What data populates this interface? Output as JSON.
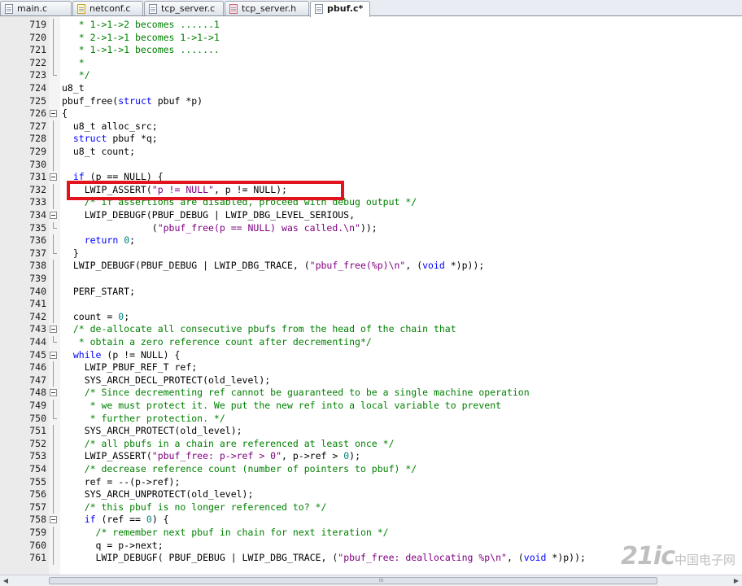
{
  "tabs": [
    {
      "label": "main.c",
      "color": "blue",
      "active": false
    },
    {
      "label": "netconf.c",
      "color": "yellow",
      "active": false
    },
    {
      "label": "tcp_server.c",
      "color": "blue",
      "active": false
    },
    {
      "label": "tcp_server.h",
      "color": "pink",
      "active": false
    },
    {
      "label": "pbuf.c*",
      "color": "blue",
      "active": true
    }
  ],
  "colors": {
    "keyword": "#0000ff",
    "string": "#800080",
    "comment": "#008000",
    "number": "#008080",
    "highlight_box": "#e2121f"
  },
  "lines": [
    {
      "n": "719",
      "fold": "line",
      "segs": [
        [
          "cm",
          "   * 1->1->2 becomes ......1"
        ]
      ]
    },
    {
      "n": "720",
      "fold": "line",
      "segs": [
        [
          "cm",
          "   * 2->1->1 becomes 1->1->1"
        ]
      ]
    },
    {
      "n": "721",
      "fold": "line",
      "segs": [
        [
          "cm",
          "   * 1->1->1 becomes ......."
        ]
      ]
    },
    {
      "n": "722",
      "fold": "line",
      "segs": [
        [
          "cm",
          "   *"
        ]
      ]
    },
    {
      "n": "723",
      "fold": "end",
      "segs": [
        [
          "cm",
          "   */"
        ]
      ]
    },
    {
      "n": "724",
      "fold": "",
      "segs": [
        [
          "",
          "u8_t"
        ]
      ]
    },
    {
      "n": "725",
      "fold": "",
      "segs": [
        [
          "",
          "pbuf_free("
        ],
        [
          "kw",
          "struct"
        ],
        [
          "",
          " pbuf *p)"
        ]
      ]
    },
    {
      "n": "726",
      "fold": "box",
      "segs": [
        [
          "",
          "{"
        ]
      ]
    },
    {
      "n": "727",
      "fold": "line",
      "segs": [
        [
          "",
          "  u8_t alloc_src;"
        ]
      ]
    },
    {
      "n": "728",
      "fold": "line",
      "segs": [
        [
          "",
          "  "
        ],
        [
          "kw",
          "struct"
        ],
        [
          "",
          " pbuf *q;"
        ]
      ]
    },
    {
      "n": "729",
      "fold": "line",
      "segs": [
        [
          "",
          "  u8_t count;"
        ]
      ]
    },
    {
      "n": "730",
      "fold": "line",
      "segs": [
        [
          "",
          ""
        ]
      ]
    },
    {
      "n": "731",
      "fold": "box",
      "segs": [
        [
          "",
          "  "
        ],
        [
          "kw",
          "if"
        ],
        [
          "",
          " (p == NULL) {"
        ]
      ]
    },
    {
      "n": "732",
      "fold": "line",
      "segs": [
        [
          "",
          "    LWIP_ASSERT("
        ],
        [
          "str",
          "\"p != NULL\""
        ],
        [
          "",
          ", p != NULL);"
        ]
      ]
    },
    {
      "n": "733",
      "fold": "line",
      "segs": [
        [
          "cm",
          "    /* if assertions are disabled, proceed with debug output */"
        ]
      ]
    },
    {
      "n": "734",
      "fold": "box",
      "segs": [
        [
          "",
          "    LWIP_DEBUGF(PBUF_DEBUG | LWIP_DBG_LEVEL_SERIOUS,"
        ]
      ]
    },
    {
      "n": "735",
      "fold": "end",
      "segs": [
        [
          "",
          "                ("
        ],
        [
          "str",
          "\"pbuf_free(p == NULL) was called.\\n\""
        ],
        [
          "",
          "));"
        ]
      ]
    },
    {
      "n": "736",
      "fold": "line",
      "segs": [
        [
          "",
          "    "
        ],
        [
          "kw",
          "return"
        ],
        [
          "",
          " "
        ],
        [
          "num",
          "0"
        ],
        [
          "",
          ";"
        ]
      ]
    },
    {
      "n": "737",
      "fold": "end",
      "segs": [
        [
          "",
          "  }"
        ]
      ]
    },
    {
      "n": "738",
      "fold": "line",
      "segs": [
        [
          "",
          "  LWIP_DEBUGF(PBUF_DEBUG | LWIP_DBG_TRACE, ("
        ],
        [
          "str",
          "\"pbuf_free(%p)\\n\""
        ],
        [
          "",
          ", ("
        ],
        [
          "kw",
          "void"
        ],
        [
          "",
          " *)p));"
        ]
      ]
    },
    {
      "n": "739",
      "fold": "line",
      "segs": [
        [
          "",
          ""
        ]
      ]
    },
    {
      "n": "740",
      "fold": "line",
      "segs": [
        [
          "",
          "  PERF_START;"
        ]
      ]
    },
    {
      "n": "741",
      "fold": "line",
      "segs": [
        [
          "",
          ""
        ]
      ]
    },
    {
      "n": "742",
      "fold": "line",
      "segs": [
        [
          "",
          "  count = "
        ],
        [
          "num",
          "0"
        ],
        [
          "",
          ";"
        ]
      ]
    },
    {
      "n": "743",
      "fold": "box",
      "segs": [
        [
          "cm",
          "  /* de-allocate all consecutive pbufs from the head of the chain that"
        ]
      ]
    },
    {
      "n": "744",
      "fold": "end",
      "segs": [
        [
          "cm",
          "   * obtain a zero reference count after decrementing*/"
        ]
      ]
    },
    {
      "n": "745",
      "fold": "box",
      "segs": [
        [
          "",
          "  "
        ],
        [
          "kw",
          "while"
        ],
        [
          "",
          " (p != NULL) {"
        ]
      ]
    },
    {
      "n": "746",
      "fold": "line",
      "segs": [
        [
          "",
          "    LWIP_PBUF_REF_T ref;"
        ]
      ]
    },
    {
      "n": "747",
      "fold": "line",
      "segs": [
        [
          "",
          "    SYS_ARCH_DECL_PROTECT(old_level);"
        ]
      ]
    },
    {
      "n": "748",
      "fold": "box",
      "segs": [
        [
          "cm",
          "    /* Since decrementing ref cannot be guaranteed to be a single machine operation"
        ]
      ]
    },
    {
      "n": "749",
      "fold": "line",
      "segs": [
        [
          "cm",
          "     * we must protect it. We put the new ref into a local variable to prevent"
        ]
      ]
    },
    {
      "n": "750",
      "fold": "end",
      "segs": [
        [
          "cm",
          "     * further protection. */"
        ]
      ]
    },
    {
      "n": "751",
      "fold": "line",
      "segs": [
        [
          "",
          "    SYS_ARCH_PROTECT(old_level);"
        ]
      ]
    },
    {
      "n": "752",
      "fold": "line",
      "segs": [
        [
          "cm",
          "    /* all pbufs in a chain are referenced at least once */"
        ]
      ]
    },
    {
      "n": "753",
      "fold": "line",
      "segs": [
        [
          "",
          "    LWIP_ASSERT("
        ],
        [
          "str",
          "\"pbuf_free: p->ref > 0\""
        ],
        [
          "",
          ", p->ref > "
        ],
        [
          "num",
          "0"
        ],
        [
          "",
          ");"
        ]
      ]
    },
    {
      "n": "754",
      "fold": "line",
      "segs": [
        [
          "cm",
          "    /* decrease reference count (number of pointers to pbuf) */"
        ]
      ]
    },
    {
      "n": "755",
      "fold": "line",
      "segs": [
        [
          "",
          "    ref = --(p->ref);"
        ]
      ]
    },
    {
      "n": "756",
      "fold": "line",
      "segs": [
        [
          "",
          "    SYS_ARCH_UNPROTECT(old_level);"
        ]
      ]
    },
    {
      "n": "757",
      "fold": "line",
      "segs": [
        [
          "cm",
          "    /* this pbuf is no longer referenced to? */"
        ]
      ]
    },
    {
      "n": "758",
      "fold": "box",
      "segs": [
        [
          "",
          "    "
        ],
        [
          "kw",
          "if"
        ],
        [
          "",
          " (ref == "
        ],
        [
          "num",
          "0"
        ],
        [
          "",
          ") {"
        ]
      ]
    },
    {
      "n": "759",
      "fold": "line",
      "segs": [
        [
          "cm",
          "      /* remember next pbuf in chain for next iteration */"
        ]
      ]
    },
    {
      "n": "760",
      "fold": "line",
      "segs": [
        [
          "",
          "      q = p->next;"
        ]
      ]
    },
    {
      "n": "761",
      "fold": "line",
      "segs": [
        [
          "",
          "      LWIP_DEBUGF( PBUF_DEBUG | LWIP_DBG_TRACE, ("
        ],
        [
          "str",
          "\"pbuf_free: deallocating %p\\n\""
        ],
        [
          "",
          ", ("
        ],
        [
          "kw",
          "void"
        ],
        [
          "",
          " *)p));"
        ]
      ]
    }
  ],
  "scrollbar": {
    "grip": "III",
    "left_arrow": "◀",
    "right_arrow": "▶"
  },
  "watermark": {
    "logo": "21ic",
    "text": "中国电子网"
  }
}
